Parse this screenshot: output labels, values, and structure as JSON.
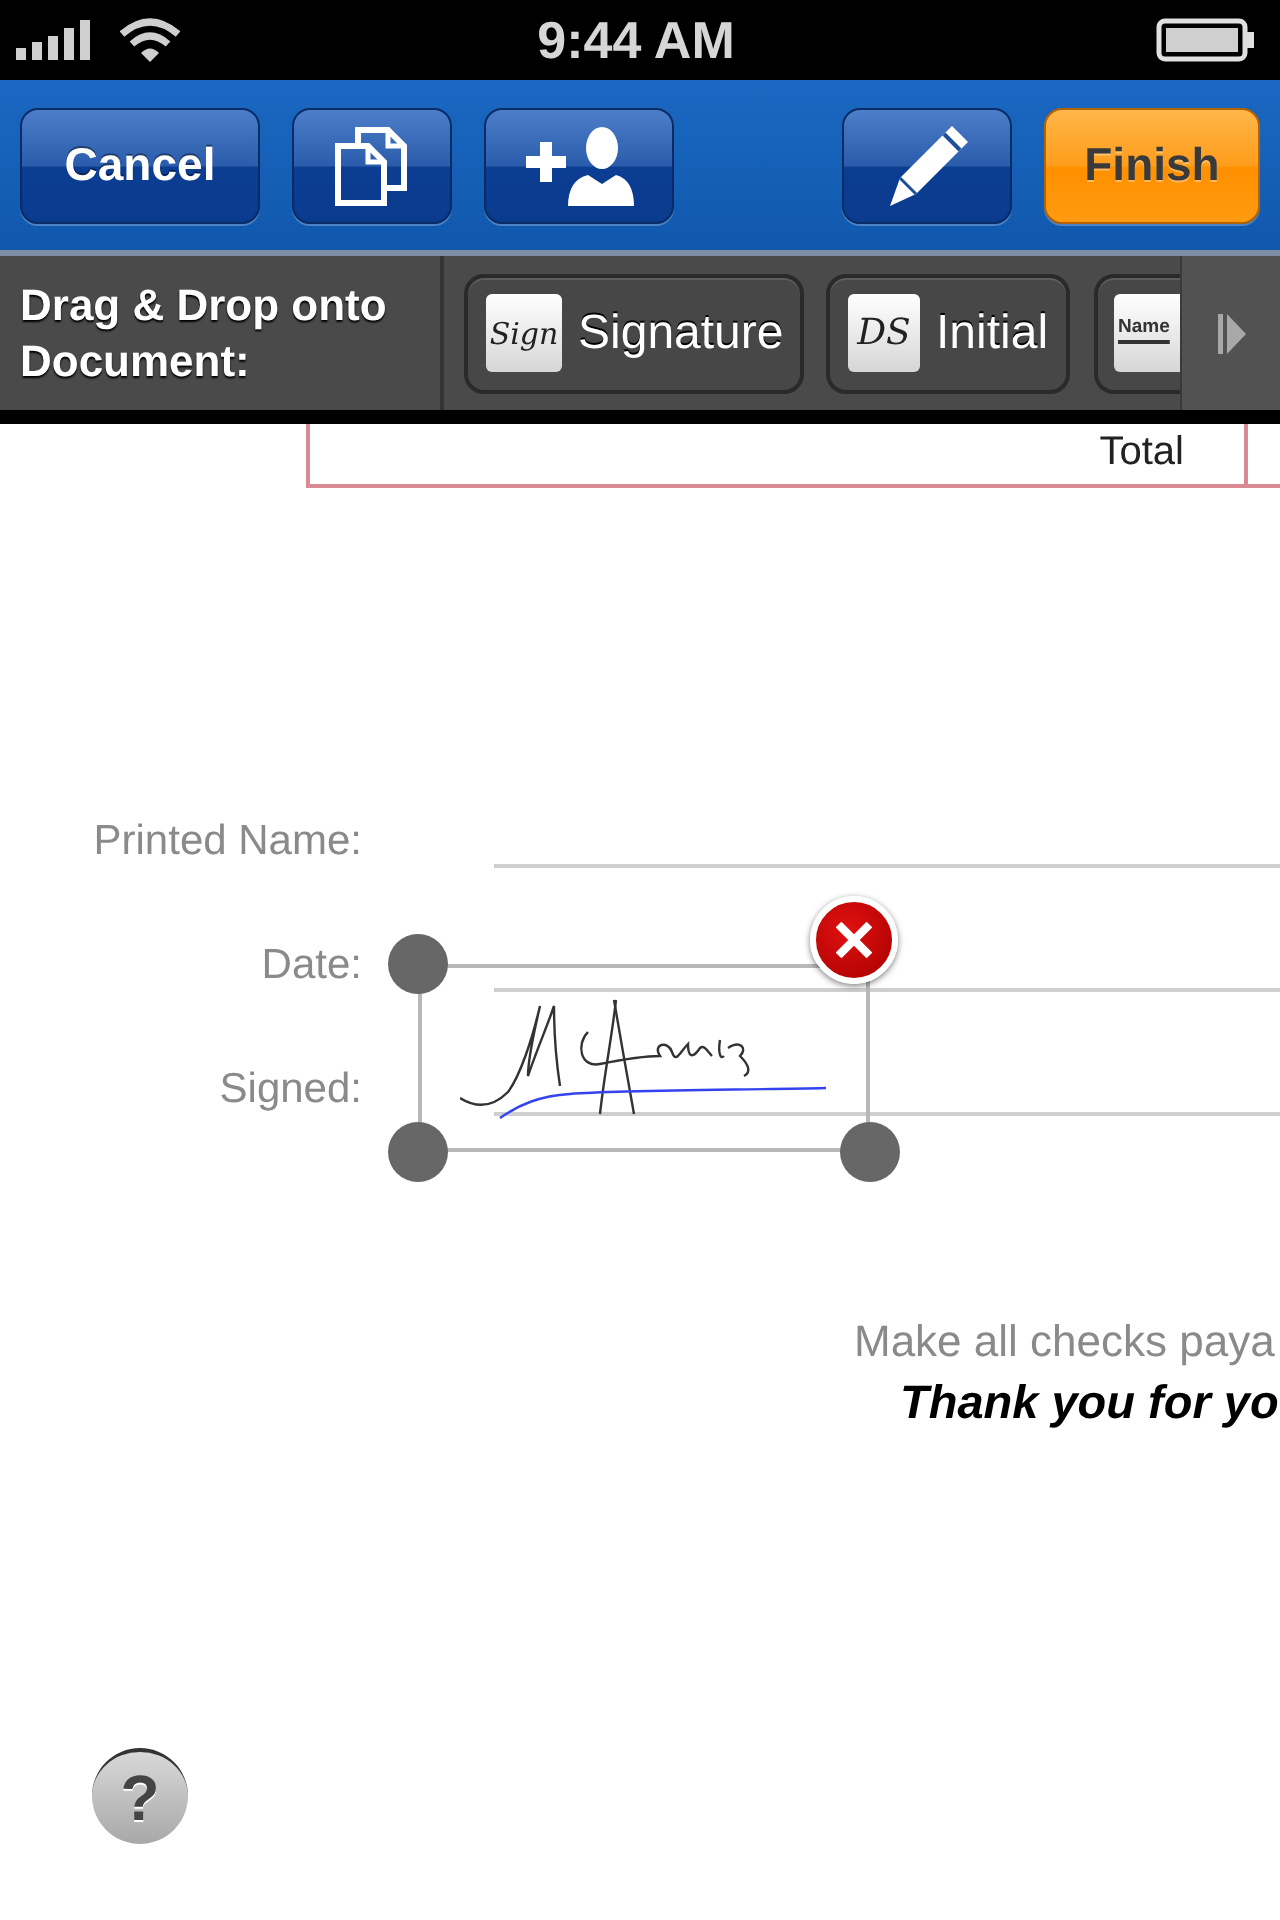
{
  "status_bar": {
    "time": "9:44 AM"
  },
  "toolbar": {
    "left": [
      {
        "kind": "cancel",
        "label": "Cancel"
      },
      {
        "kind": "pages"
      },
      {
        "kind": "signer"
      }
    ],
    "right": [
      {
        "kind": "annotate"
      },
      {
        "kind": "finish",
        "label": "Finish"
      }
    ]
  },
  "drag_bar": {
    "prompt": "Drag & Drop onto Document:",
    "tools": [
      {
        "kind": "signature",
        "tile_text": "Sign",
        "label": "Signature"
      },
      {
        "kind": "initial",
        "tile_text": "DS",
        "label": "Initial"
      },
      {
        "kind": "name",
        "tile_text": "Name"
      }
    ]
  },
  "document": {
    "table_row": {
      "label": "Total"
    },
    "fields": [
      {
        "label": "Printed Name:"
      },
      {
        "label": "Date:"
      },
      {
        "label": "Signed:"
      }
    ],
    "signature": {
      "selected": true
    },
    "footer": {
      "note": "Make all checks paya",
      "thanks": "Thank you for yo"
    }
  },
  "help": {
    "label": "?"
  }
}
